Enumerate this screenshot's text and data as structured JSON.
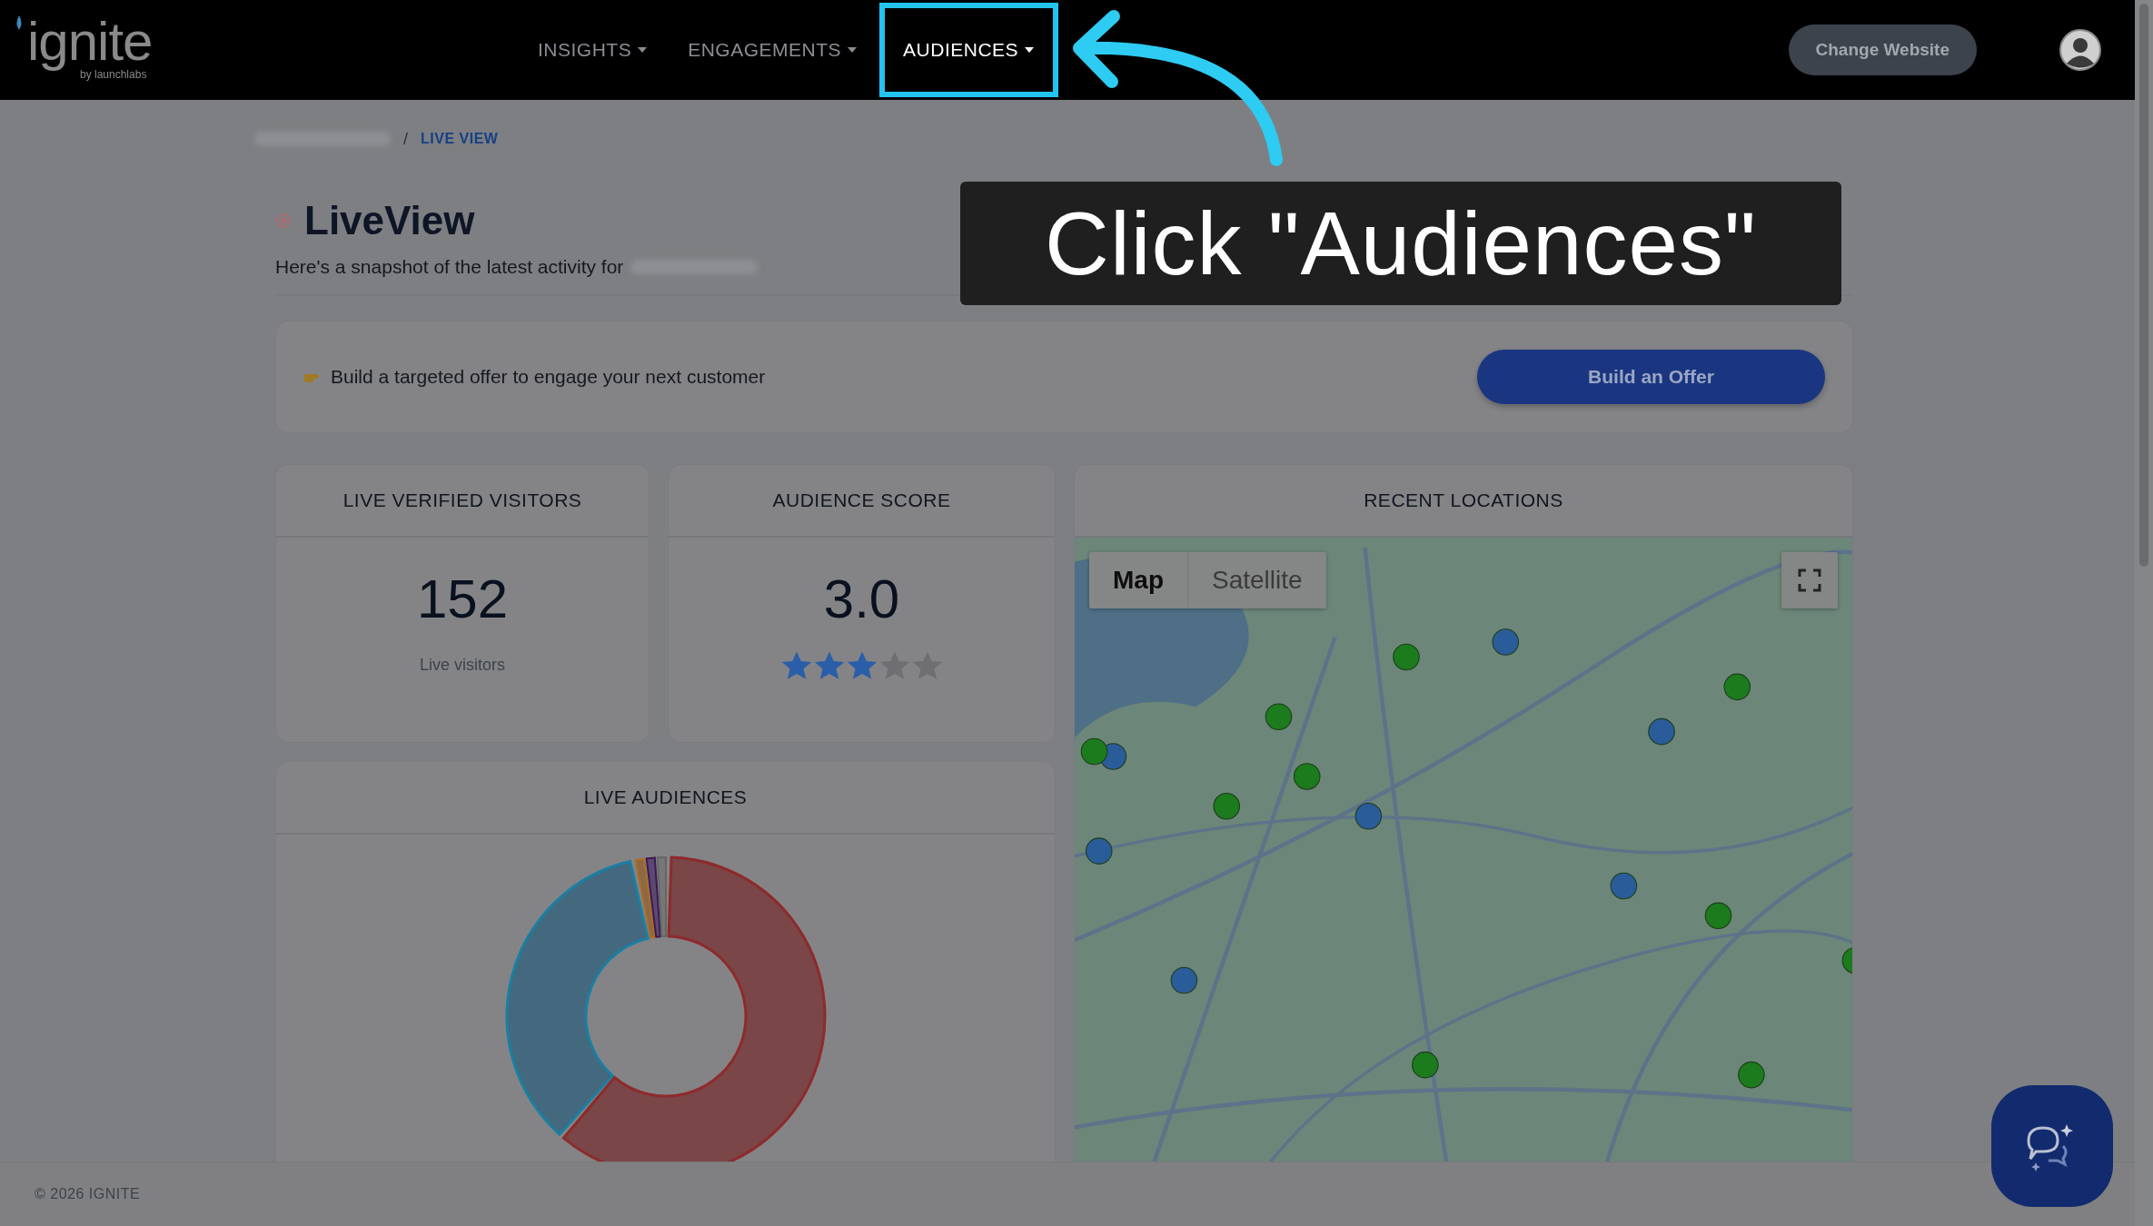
{
  "header": {
    "logo": {
      "name": "ignite",
      "byline": "by launchlabs"
    },
    "nav": [
      {
        "label": "INSIGHTS",
        "selected": false
      },
      {
        "label": "ENGAGEMENTS",
        "selected": false
      },
      {
        "label": "AUDIENCES",
        "selected": true
      }
    ],
    "change_website": "Change Website"
  },
  "breadcrumb": {
    "separator": "/",
    "current": "LIVE VIEW"
  },
  "page": {
    "title": "LiveView",
    "subtitle": "Here's a snapshot of the latest activity for"
  },
  "offer": {
    "text": "Build a targeted offer to engage your next customer",
    "button": "Build an Offer"
  },
  "visitors": {
    "title": "LIVE VERIFIED VISITORS",
    "value": "152",
    "caption": "Live visitors"
  },
  "score": {
    "title": "AUDIENCE SCORE",
    "value": "3.0",
    "stars": 3
  },
  "locations": {
    "title": "RECENT LOCATIONS",
    "map_types": [
      {
        "label": "Map",
        "selected": true
      },
      {
        "label": "Satellite",
        "selected": false
      }
    ]
  },
  "audiences": {
    "title": "LIVE AUDIENCES"
  },
  "footer": "© 2026 IGNITE",
  "callout": {
    "text": "Click \"Audiences\""
  }
}
